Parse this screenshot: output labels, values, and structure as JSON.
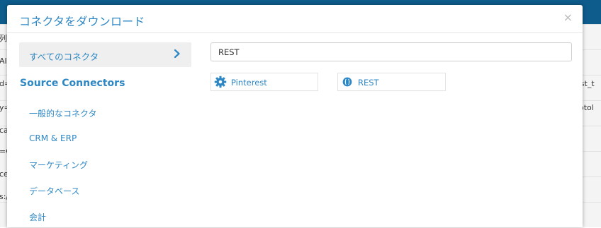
{
  "background": {
    "left_fragments": [
      "列",
      "Alz",
      "d=s",
      "y=",
      "cal",
      "=C",
      "ces",
      "s:/"
    ],
    "right_fragments": [
      "sist_t",
      "notol"
    ]
  },
  "modal": {
    "title": "コネクタをダウンロード",
    "close_label": "×"
  },
  "sidebar": {
    "selected_label": "すべてのコネクタ",
    "section_title": "Source Connectors",
    "items": [
      {
        "label": "一般的なコネクタ"
      },
      {
        "label": "CRM & ERP"
      },
      {
        "label": "マーケティング"
      },
      {
        "label": "データベース"
      },
      {
        "label": "会計"
      }
    ]
  },
  "search": {
    "value": "REST"
  },
  "results": [
    {
      "label": "Pinterest",
      "icon": "gear-icon"
    },
    {
      "label": "REST",
      "icon": "rest-icon"
    }
  ],
  "colors": {
    "accent": "#2d87c4",
    "topbar": "#0e5c8c"
  }
}
